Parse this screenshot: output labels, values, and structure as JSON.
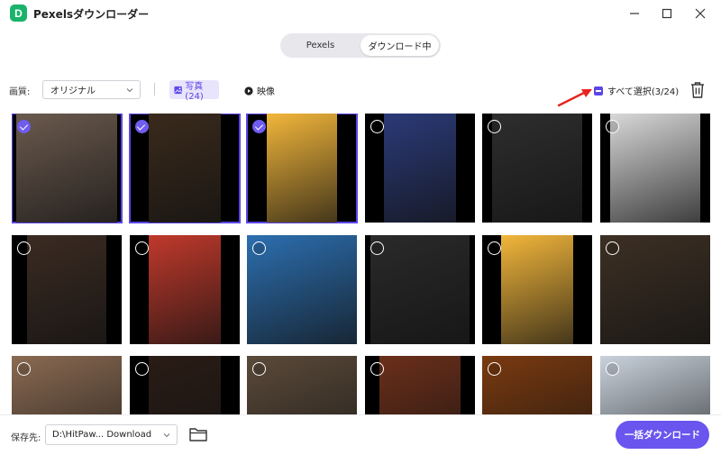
{
  "window": {
    "title": "Pexelsダウンローダー",
    "logo_letter": "D",
    "accent": "#5b46e8",
    "brand": "#19b36b"
  },
  "tabs": [
    {
      "label": "Pexels",
      "active": false
    },
    {
      "label": "ダウンロード中",
      "active": true
    }
  ],
  "filter": {
    "quality_label": "画質:",
    "quality_value": "オリジナル",
    "photo_label": "写真(24)",
    "video_label": "映像",
    "select_all_label": "すべて選択(3/24)"
  },
  "grid": {
    "tiles": [
      {
        "selected": true,
        "color": "#6b5a4e"
      },
      {
        "selected": true,
        "color": "#3a2a1c"
      },
      {
        "selected": true,
        "color": "#f2b63b"
      },
      {
        "selected": false,
        "color": "#2b3a78"
      },
      {
        "selected": false,
        "color": "#2e2e2e"
      },
      {
        "selected": false,
        "color": "#d8d8d8"
      },
      {
        "selected": false,
        "color": "#3b2b22"
      },
      {
        "selected": false,
        "color": "#c0392b"
      },
      {
        "selected": false,
        "color": "#2c6fb0"
      },
      {
        "selected": false,
        "color": "#2a2a2a"
      },
      {
        "selected": false,
        "color": "#f2b63b"
      },
      {
        "selected": false,
        "color": "#3d3024"
      },
      {
        "selected": false,
        "color": "#8a6a52"
      },
      {
        "selected": false,
        "color": "#2a1c16"
      },
      {
        "selected": false,
        "color": "#5b4a3a"
      },
      {
        "selected": false,
        "color": "#6b2f1a"
      },
      {
        "selected": false,
        "color": "#7a3a10"
      },
      {
        "selected": false,
        "color": "#c9d2dc"
      }
    ]
  },
  "footer": {
    "save_label": "保存先:",
    "save_path": "D:\\HitPaw... Download",
    "download_label": "一括ダウンロード"
  },
  "annotation_color": "#e8251f"
}
